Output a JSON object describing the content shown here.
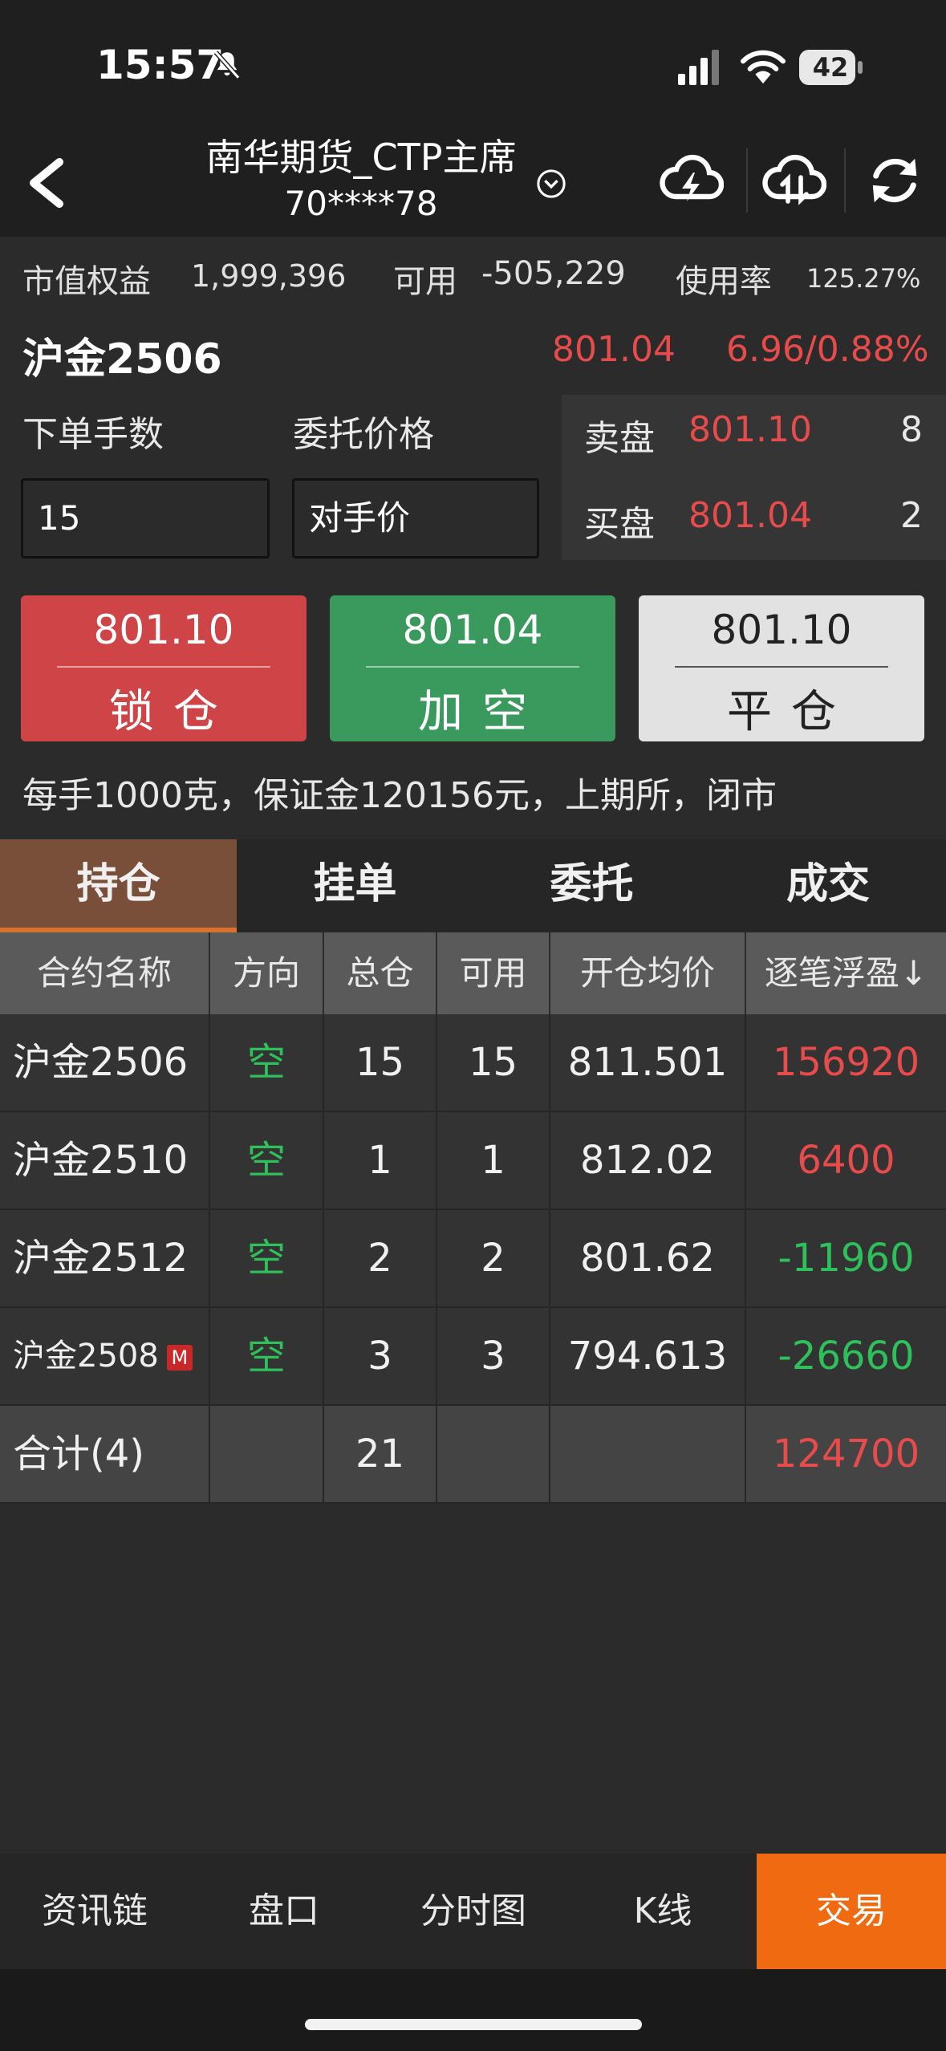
{
  "status": {
    "time": "15:57",
    "battery": "42"
  },
  "nav": {
    "title": "南华期货_CTP主席",
    "account": "70****78"
  },
  "account": {
    "equity_label": "市值权益",
    "equity": "1,999,396",
    "avail_label": "可用",
    "avail": "-505,229",
    "usage_label": "使用率",
    "usage": "125.27%"
  },
  "contract": {
    "name": "沪金2506",
    "last": "801.04",
    "change": "6.96/0.88%"
  },
  "form": {
    "qty_label": "下单手数",
    "price_label": "委托价格",
    "qty_value": "15",
    "price_value": "对手价"
  },
  "book": {
    "ask_label": "卖盘",
    "ask_price": "801.10",
    "ask_qty": "8",
    "bid_label": "买盘",
    "bid_price": "801.04",
    "bid_qty": "2"
  },
  "actions": [
    {
      "price": "801.10",
      "label": "锁仓"
    },
    {
      "price": "801.04",
      "label": "加空"
    },
    {
      "price": "801.10",
      "label": "平仓"
    }
  ],
  "info": "每手1000克，保证金120156元，上期所，闭市",
  "tabs": [
    "持仓",
    "挂单",
    "委托",
    "成交"
  ],
  "table": {
    "headers": [
      "合约名称",
      "方向",
      "总仓",
      "可用",
      "开仓均价",
      "逐笔浮盈↓"
    ],
    "rows": [
      {
        "name": "沪金2506",
        "dir": "空",
        "total": "15",
        "avail": "15",
        "avg": "811.501",
        "pnl": "156920"
      },
      {
        "name": "沪金2510",
        "dir": "空",
        "total": "1",
        "avail": "1",
        "avg": "812.02",
        "pnl": "6400"
      },
      {
        "name": "沪金2512",
        "dir": "空",
        "total": "2",
        "avail": "2",
        "avg": "801.62",
        "pnl": "-11960"
      },
      {
        "name": "沪金2508",
        "badge": "M",
        "dir": "空",
        "total": "3",
        "avail": "3",
        "avg": "794.613",
        "pnl": "-26660"
      }
    ],
    "summary": {
      "label": "合计(4)",
      "total": "21",
      "pnl": "124700"
    }
  },
  "bottom_nav": [
    "资讯链",
    "盘口",
    "分时图",
    "K线",
    "交易"
  ],
  "colors": {
    "accent": "#ef6a10",
    "up": "#e84b4b",
    "down": "#2ec05a",
    "lock": "#cf4446",
    "short": "#3a9a5e"
  }
}
